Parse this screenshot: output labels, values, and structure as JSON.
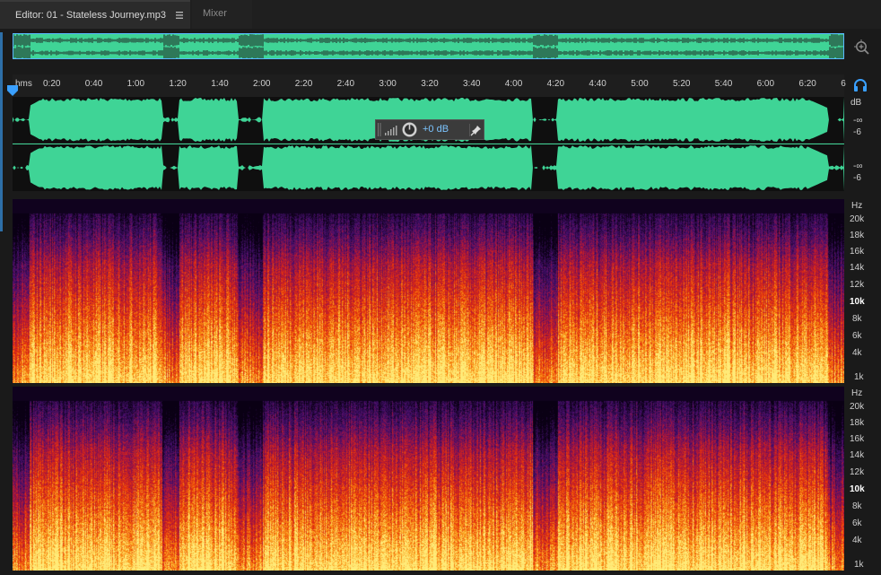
{
  "tabs": {
    "editor_label": "Editor: 01 - Stateless Journey.mp3",
    "mixer_label": "Mixer"
  },
  "ruler": {
    "unit": "hms",
    "ticks": [
      "0:20",
      "0:40",
      "1:00",
      "1:20",
      "1:40",
      "2:00",
      "2:20",
      "2:40",
      "3:00",
      "3:20",
      "3:40",
      "4:00",
      "4:20",
      "4:40",
      "5:00",
      "5:20",
      "5:40",
      "6:00",
      "6:20",
      "6"
    ]
  },
  "amplitude_scale": {
    "unit": "dB",
    "channel1": [
      "-∞",
      "-6"
    ],
    "channel2": [
      "-∞",
      "-6"
    ]
  },
  "hud": {
    "volume": "+0 dB"
  },
  "spectral_scale": {
    "unit": "Hz",
    "labels": [
      "20k",
      "18k",
      "16k",
      "14k",
      "12k",
      "10k",
      "8k",
      "6k",
      "4k",
      "1k"
    ]
  },
  "colors": {
    "waveform": "#3fd496",
    "accent": "#3aa0ff"
  },
  "icons": {
    "zoom": "zoom-in-icon",
    "snap": "headphone-snap-icon",
    "hud_knob": "volume-knob-icon",
    "hud_pin": "pin-icon"
  }
}
